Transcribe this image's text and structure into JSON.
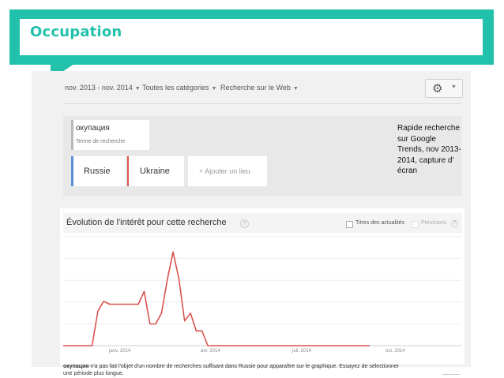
{
  "slide": {
    "title": "Occupation",
    "note": "Rapide recherche sur Google Trends, nov 2013-2014, capture d’ écran",
    "accent_color": "#21c1ac"
  },
  "toolbar": {
    "date_range": "nov. 2013 - nov. 2014",
    "category": "Toutes les catégories",
    "search_type": "Recherche sur le Web",
    "settings_icon": "gear-icon",
    "dropdown_icon": "caret-down-icon"
  },
  "search": {
    "term": "окупация",
    "term_sub": "Terme de recherche"
  },
  "locations": [
    {
      "label": "Russie",
      "color": "#5b8fd8"
    },
    {
      "label": "Ukraine",
      "color": "#d9534f"
    }
  ],
  "add_location": "+ Ajouter un lieu",
  "chart_header": {
    "title": "Évolution de l'intérêt pour cette recherche",
    "help_icon": "question-icon",
    "news_checkbox_label": "Titres des actualités",
    "forecast_checkbox_label": "Prévisions"
  },
  "chart_data": {
    "type": "line",
    "title": "",
    "xlabel": "",
    "ylabel": "",
    "x_tick_labels": [
      "janv. 2014",
      "avr. 2014",
      "juil. 2014",
      "oct. 2014"
    ],
    "grid": true,
    "series": [
      {
        "name": "Ukraine",
        "color": "#d9534f",
        "x": [
          0,
          1,
          2,
          3,
          4,
          5,
          6,
          7,
          8,
          9,
          10,
          11,
          12,
          13,
          14,
          15,
          16,
          17,
          18,
          19,
          20,
          21,
          22,
          23,
          24,
          25,
          26,
          27,
          28,
          29,
          30,
          31,
          32,
          33,
          34,
          35,
          36,
          37,
          38,
          39,
          40,
          41,
          42,
          43,
          44,
          45,
          46,
          47,
          48,
          49,
          50,
          51,
          52,
          53
        ],
        "values": [
          0,
          0,
          0,
          0,
          0,
          0,
          35,
          45,
          42,
          42,
          42,
          42,
          42,
          42,
          55,
          22,
          22,
          33,
          67,
          95,
          68,
          25,
          33,
          15,
          15,
          0,
          0,
          0,
          0,
          0,
          0,
          0,
          0,
          0,
          0,
          0,
          0,
          0,
          0,
          0,
          0,
          0,
          0,
          0,
          0,
          0,
          0,
          0,
          0,
          0,
          0,
          0,
          0,
          0
        ]
      }
    ]
  },
  "footer": {
    "term": "окупация",
    "message": " n'a pas fait l'objet d'un nombre de recherches suffisant dans Russie pour apparaître sur le graphique. Essayez de sélectionner une période plus longue."
  }
}
